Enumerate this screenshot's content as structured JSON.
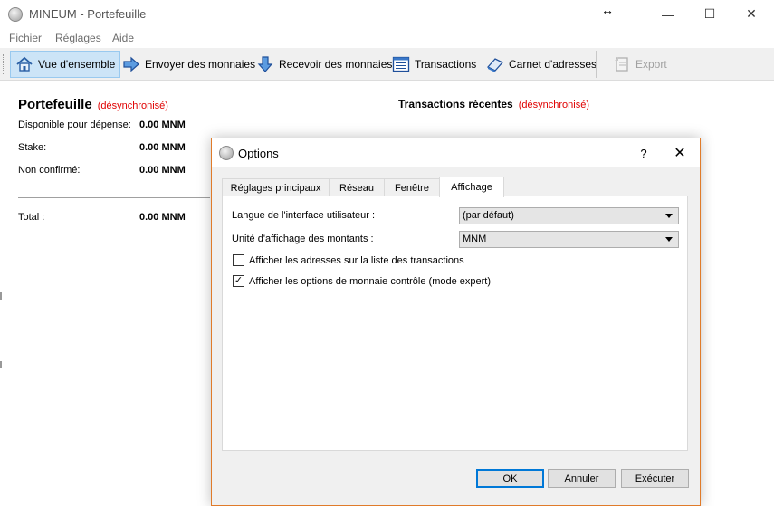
{
  "window": {
    "title": "MINEUM - Portefeuille",
    "minimize_glyph": "—",
    "maximize_glyph": "☐",
    "close_glyph": "✕",
    "resize_cursor_glyph": "↔"
  },
  "menu": {
    "items": [
      "Fichier",
      "Réglages",
      "Aide"
    ]
  },
  "toolbar": {
    "buttons": [
      {
        "label": "Vue d'ensemble",
        "icon": "home-icon",
        "active": true
      },
      {
        "label": "Envoyer des monnaies",
        "icon": "send-arrow-icon",
        "active": false
      },
      {
        "label": "Recevoir des monnaies",
        "icon": "receive-arrow-icon",
        "active": false
      },
      {
        "label": "Transactions",
        "icon": "transactions-list-icon",
        "active": false
      },
      {
        "label": "Carnet d'adresses",
        "icon": "address-book-icon",
        "active": false
      },
      {
        "label": "Export",
        "icon": "export-icon",
        "active": false,
        "disabled": true
      }
    ]
  },
  "overview": {
    "wallet_title": "Portefeuille",
    "unsync_label": "(désynchronisé)",
    "recent_title": "Transactions récentes",
    "balances": [
      {
        "label": "Disponible pour dépense:",
        "value": "0.00 MNM"
      },
      {
        "label": "Stake:",
        "value": "0.00 MNM"
      },
      {
        "label": "Non confirmé:",
        "value": "0.00 MNM"
      }
    ],
    "total": {
      "label": "Total :",
      "value": "0.00 MNM"
    }
  },
  "dialog": {
    "title": "Options",
    "help_glyph": "?",
    "close_glyph": "✕",
    "tabs": [
      "Réglages principaux",
      "Réseau",
      "Fenêtre",
      "Affichage"
    ],
    "active_tab": "Affichage",
    "language_label": "Langue de l'interface utilisateur :",
    "language_value": "(par défaut)",
    "unit_label": "Unité d'affichage des montants :",
    "unit_value": "MNM",
    "checkbox_addresses": {
      "label": "Afficher les adresses sur la liste des transactions",
      "checked": false
    },
    "checkbox_coin_control": {
      "label": "Afficher les options de monnaie  contrôle (mode expert)",
      "checked": true
    },
    "buttons": {
      "ok": "OK",
      "cancel": "Annuler",
      "apply": "Exécuter"
    }
  },
  "colors": {
    "accent": "#0078d7",
    "unsync_red": "#e00000",
    "dialog_border": "#e07b2a",
    "active_toolbar_bg": "#cce4f7"
  }
}
